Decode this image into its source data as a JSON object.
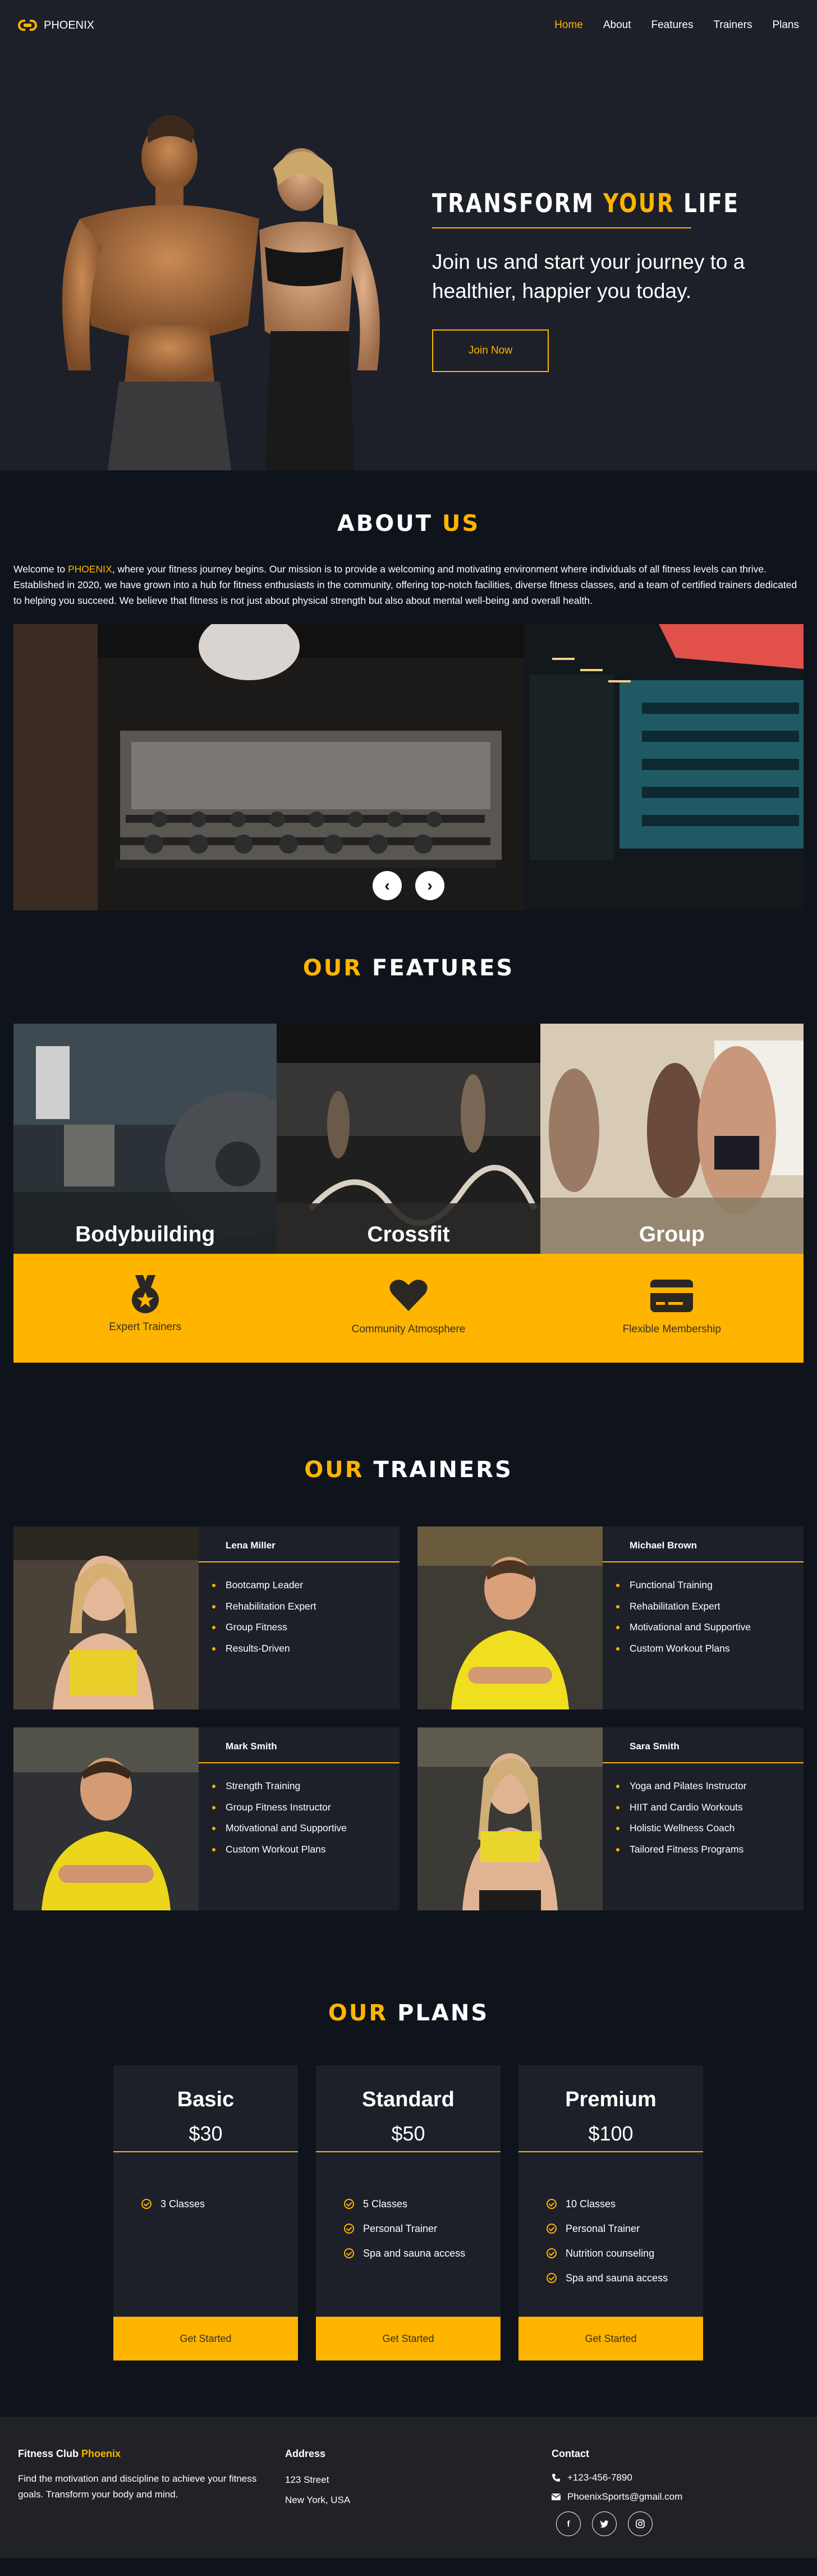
{
  "nav": {
    "brand": "PHOENIX",
    "items": [
      {
        "label": "Home",
        "active": true
      },
      {
        "label": "About",
        "active": false
      },
      {
        "label": "Features",
        "active": false
      },
      {
        "label": "Trainers",
        "active": false
      },
      {
        "label": "Plans",
        "active": false
      }
    ]
  },
  "hero": {
    "title_a": "TRANSFORM ",
    "title_b": "YOUR",
    "title_c": " LIFE",
    "subtitle": "Join us and start your journey to a healthier, happier you today.",
    "cta": "Join Now"
  },
  "about": {
    "title_a": "ABOUT ",
    "title_b": "US",
    "text_before": "Welcome to ",
    "text_brand": "PHOENIX",
    "text_after": ", where your fitness journey begins. Our mission is to provide a welcoming and motivating environment where individuals of all fitness levels can thrive. Established in 2020, we have grown into a hub for fitness enthusiasts in the community, offering top-notch facilities, diverse fitness classes, and a team of certified trainers dedicated to helping you succeed. We believe that fitness is not just about physical strength but also about mental well-being and overall health.",
    "prev": "‹",
    "next": "›"
  },
  "features": {
    "title_a": "OUR",
    "title_b": " FEATURES",
    "cards": [
      "Bodybuilding",
      "Crossfit",
      "Group"
    ],
    "items": [
      {
        "label": "Expert Trainers",
        "icon": "medal-icon"
      },
      {
        "label": "Community Atmosphere",
        "icon": "heart-icon"
      },
      {
        "label": "Flexible Membership",
        "icon": "credit-card-icon"
      }
    ]
  },
  "trainers": {
    "title_a": "OUR",
    "title_b": " TRAINERS",
    "list": [
      {
        "name": "Lena Miller",
        "skills": [
          "Bootcamp Leader",
          "Rehabilitation Expert",
          "Group Fitness",
          "Results-Driven"
        ]
      },
      {
        "name": "Michael Brown",
        "skills": [
          "Functional Training",
          "Rehabilitation Expert",
          "Motivational and Supportive",
          "Custom Workout Plans"
        ]
      },
      {
        "name": "Mark Smith",
        "skills": [
          "Strength Training",
          "Group Fitness Instructor",
          "Motivational and Supportive",
          "Custom Workout Plans"
        ]
      },
      {
        "name": "Sara Smith",
        "skills": [
          "Yoga and Pilates Instructor",
          "HIIT and Cardio Workouts",
          "Holistic Wellness Coach",
          "Tailored Fitness Programs"
        ]
      }
    ]
  },
  "plans": {
    "title_a": "OUR",
    "title_b": " PLANS",
    "list": [
      {
        "name": "Basic",
        "price": "$30",
        "features": [
          "3 Classes"
        ],
        "cta": "Get Started"
      },
      {
        "name": "Standard",
        "price": "$50",
        "features": [
          "5 Classes",
          "Personal Trainer",
          "Spa and sauna access"
        ],
        "cta": "Get Started"
      },
      {
        "name": "Premium",
        "price": "$100",
        "features": [
          "10 Classes",
          "Personal Trainer",
          "Nutrition counseling",
          "Spa and sauna access"
        ],
        "cta": "Get Started"
      }
    ]
  },
  "footer": {
    "club_a": "Fitness Club ",
    "club_b": "Phoenix",
    "tagline": "Find the motivation and discipline to achieve your fitness goals. Transform your body and mind.",
    "address_title": "Address",
    "address_1": "123 Street",
    "address_2": "New York, USA",
    "contact_title": "Contact",
    "phone": "+123-456-7890",
    "email": "PhoenixSports@gmail.com",
    "socials": [
      "f",
      "t",
      "ig"
    ]
  },
  "colors": {
    "accent": "#ffb400",
    "background": "#0f131c",
    "panel": "#1d2028",
    "footer": "#212226"
  }
}
